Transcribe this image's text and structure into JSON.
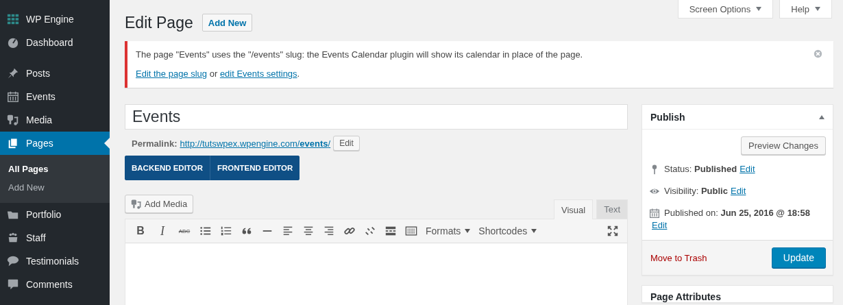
{
  "sidebar": {
    "items": [
      {
        "label": "WP Engine",
        "selected": false
      },
      {
        "label": "Dashboard",
        "selected": false
      },
      {
        "label": "Posts",
        "selected": false
      },
      {
        "label": "Events",
        "selected": false
      },
      {
        "label": "Media",
        "selected": false
      },
      {
        "label": "Pages",
        "selected": true,
        "children": [
          {
            "label": "All Pages",
            "selected": true
          },
          {
            "label": "Add New",
            "selected": false
          }
        ]
      },
      {
        "label": "Portfolio",
        "selected": false
      },
      {
        "label": "Staff",
        "selected": false
      },
      {
        "label": "Testimonials",
        "selected": false
      },
      {
        "label": "Comments",
        "selected": false
      }
    ]
  },
  "top_tabs": [
    "Screen Options",
    "Help"
  ],
  "heading": {
    "title": "Edit Page",
    "button": "Add New"
  },
  "notice": {
    "message": "The page \"Events\" uses the \"/events\" slug: the Events Calendar plugin will show its calendar in place of the page.",
    "link_1": "Edit the page slug",
    "between": " or ",
    "link_2": "edit Events settings",
    "after": "."
  },
  "title_field": {
    "value": "Events"
  },
  "permalink": {
    "label": "Permalink:",
    "url": "http://tutswpex.wpengine.com/**events**/",
    "button": "Edit"
  },
  "editor_modes": [
    "BACKEND EDITOR",
    "FRONTEND EDITOR"
  ],
  "add_media": "Add Media",
  "editor_tabs": [
    {
      "label": "Visual",
      "selected": true
    },
    {
      "label": "Text",
      "selected": false
    }
  ],
  "toolbar": [
    {
      "kind": "bold",
      "label": "B"
    },
    {
      "kind": "italic",
      "label": "I"
    },
    {
      "kind": "strike",
      "label": "ABC"
    },
    {
      "kind": "bullets"
    },
    {
      "kind": "numbers"
    },
    {
      "kind": "quote"
    },
    {
      "kind": "rule"
    },
    {
      "kind": "align-left"
    },
    {
      "kind": "align-center"
    },
    {
      "kind": "align-right"
    },
    {
      "kind": "link"
    },
    {
      "kind": "unlink"
    },
    {
      "kind": "more"
    },
    {
      "kind": "kitchen"
    },
    {
      "kind": "dropdown",
      "label": "Formats"
    },
    {
      "kind": "dropdown",
      "label": "Shortcodes"
    }
  ],
  "publish": {
    "title": "Publish",
    "preview": "Preview Changes",
    "rows": [
      {
        "text": "Status: **Published**",
        "link": "Edit"
      },
      {
        "text": "Visibility: **Public**",
        "link": "Edit"
      },
      {
        "text": "Published on: **Jun 25, 2016 @ 18:58**",
        "link": "Edit"
      }
    ],
    "trash": "Move to Trash",
    "update": "Update"
  },
  "page_attributes": {
    "title": "Page Attributes"
  }
}
